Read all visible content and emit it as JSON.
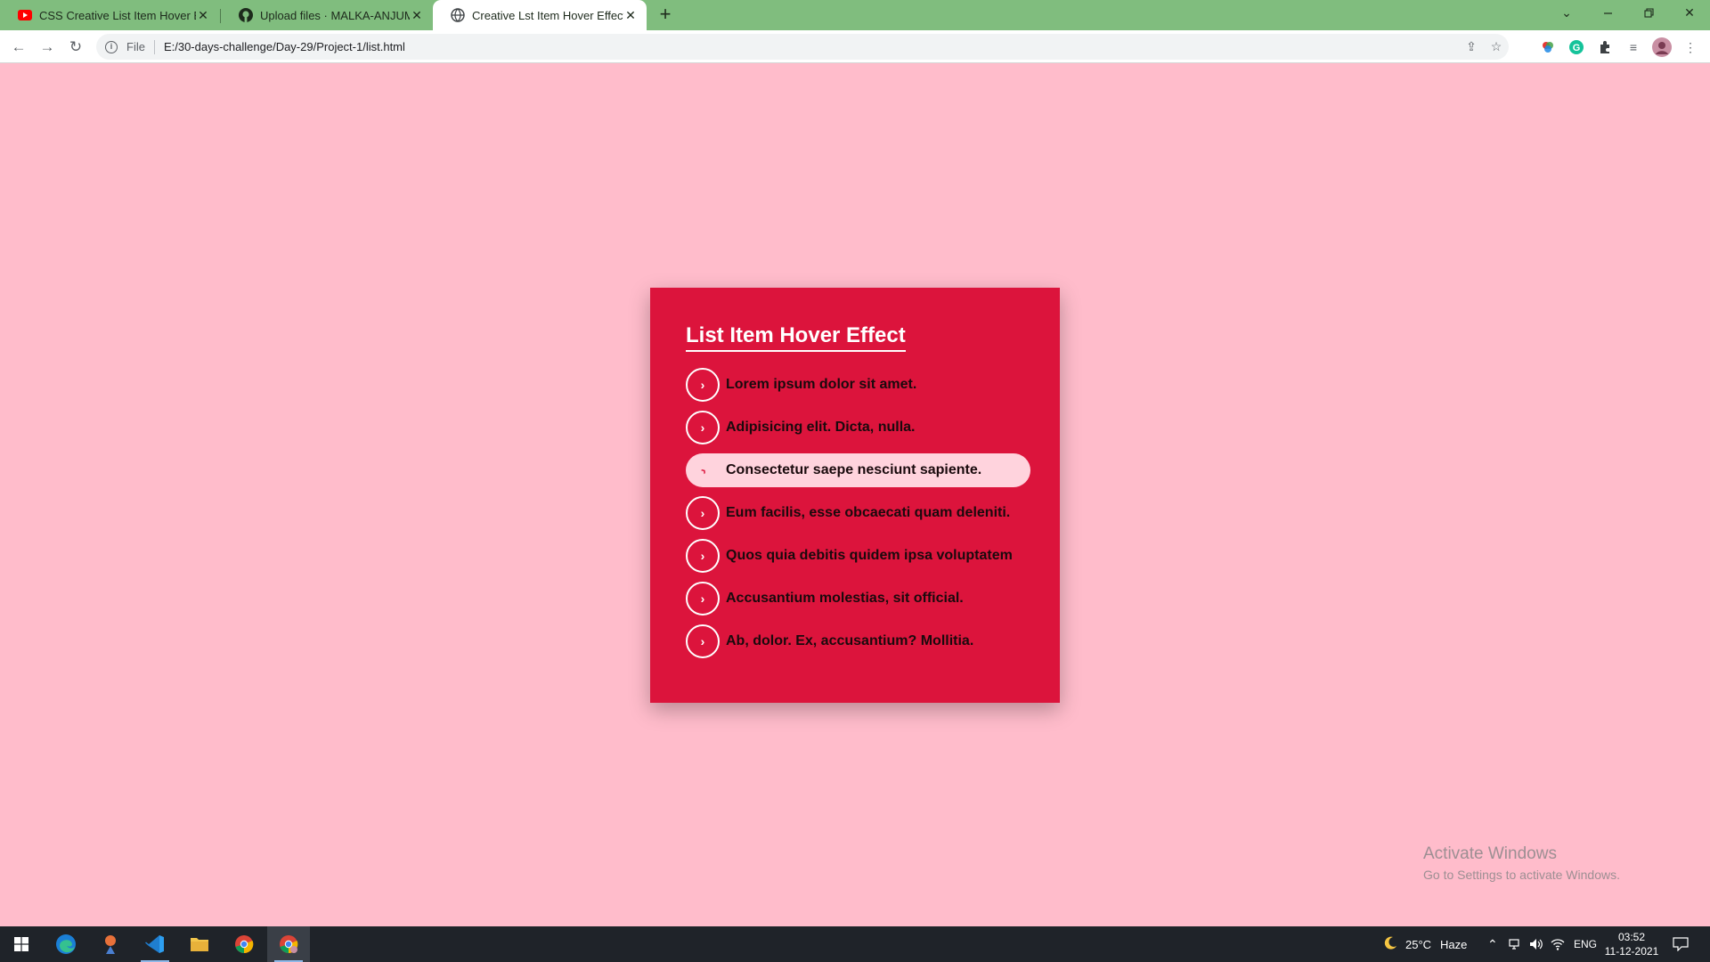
{
  "browser": {
    "tabs": [
      {
        "label": "CSS Creative List Item Hover Effe",
        "icon": "youtube-icon",
        "active": false
      },
      {
        "label": "Upload files · MALKA-ANJUM/Lis",
        "icon": "github-icon",
        "active": false
      },
      {
        "label": "Creative Lst Item Hover Effect",
        "icon": "globe-icon",
        "active": true
      }
    ],
    "new_tab": "+",
    "address": {
      "scheme": "File",
      "url": "E:/30-days-challenge/Day-29/Project-1/list.html"
    }
  },
  "page": {
    "title": "List Item Hover Effect",
    "arrow_glyph": "›",
    "items": [
      {
        "text": "Lorem ipsum dolor sit amet."
      },
      {
        "text": "Adipisicing elit. Dicta, nulla."
      },
      {
        "text": "Consectetur saepe nesciunt sapiente.",
        "hovered": true
      },
      {
        "text": "Eum facilis, esse obcaecati quam deleniti."
      },
      {
        "text": "Quos quia debitis quidem ipsa voluptatem"
      },
      {
        "text": "Accusantium molestias, sit official."
      },
      {
        "text": "Ab, dolor. Ex, accusantium? Mollitia."
      }
    ],
    "colors": {
      "background": "#ffbccb",
      "card": "#dc143c",
      "hover": "#ffd3dd"
    }
  },
  "watermark": {
    "line1": "Activate Windows",
    "line2": "Go to Settings to activate Windows."
  },
  "taskbar": {
    "apps": [
      "windows-start-icon",
      "edge-icon",
      "app-icon",
      "vscode-icon",
      "file-explorer-icon",
      "chrome-icon",
      "chrome-profile-icon"
    ],
    "weather": {
      "temp": "25°C",
      "condition": "Haze"
    },
    "language": "ENG",
    "time": "03:52",
    "date": "11-12-2021"
  }
}
